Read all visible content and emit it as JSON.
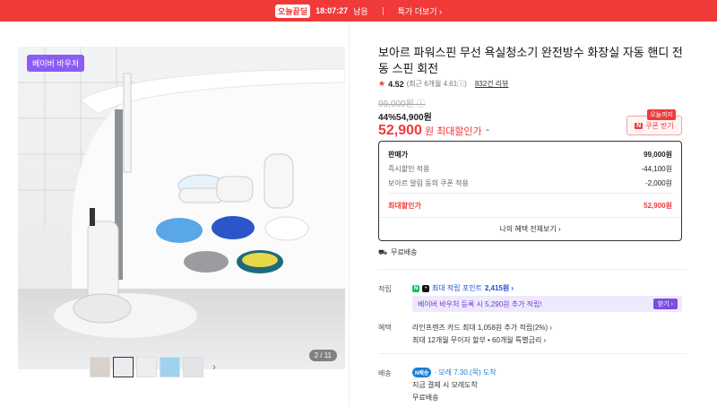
{
  "topbar": {
    "brand": "오늘끝딜",
    "timer": "18:07:27",
    "timer_suffix": "남음",
    "more": "특가 더보기 ›"
  },
  "gallery": {
    "badge": "베이버 바우처",
    "page_indicator": "2 / 11"
  },
  "product": {
    "title": "보아르 파워스핀 무선 욕실청소기 완전방수 화장실 자동 핸디 전동 스핀 회전",
    "rating": "4.52",
    "rating_recent": "(최근 6개월 4.61ⓘ)",
    "review_count": "832건 리뷰",
    "original_price": "99,000원 ⓘ",
    "discount_line": "44%54,900원",
    "max_price_num": "52,900",
    "max_price_unit": "원",
    "max_price_label": "최대할인가",
    "coupon_tag": "오늘까지",
    "coupon_label": "쿠폰 받기"
  },
  "price_box": {
    "sale_label": "판매가",
    "sale_value": "99,000원",
    "instant_label": "즉시할인 적용",
    "instant_value": "-44,100원",
    "alarm_label": "보아르 알림 동의 쿠폰 적용",
    "alarm_value": "-2,000원",
    "max_label": "최대할인가",
    "max_value": "52,900원",
    "all_benefits": "나의 혜택 전체보기 ›"
  },
  "shipping_free": "무료배송",
  "points": {
    "label": "적립",
    "earn_text": "최대 적립 포인트",
    "earn_value": "2,415원 ›",
    "voucher_text": "베이버 바우처 등록 시 5,290원 추가 적립!",
    "voucher_btn": "받기 ›"
  },
  "benefits": {
    "label": "혜택",
    "line1": "라인프렌즈 카드 최대 1,058원 추가 적립(2%) ›",
    "line2": "최대 12개월 무이자 할부 • 60개월 특별금리 ›"
  },
  "delivery": {
    "label": "배송",
    "badge": "N배송",
    "main": "· 모레 7.30.(목) 도착",
    "line1": "지금 결제 시 모레도착",
    "line2": "무료배송"
  },
  "colors": {
    "accent_red": "#f03a3a",
    "voucher_purple": "#8a5cf6",
    "naver_green": "#03c75a"
  }
}
